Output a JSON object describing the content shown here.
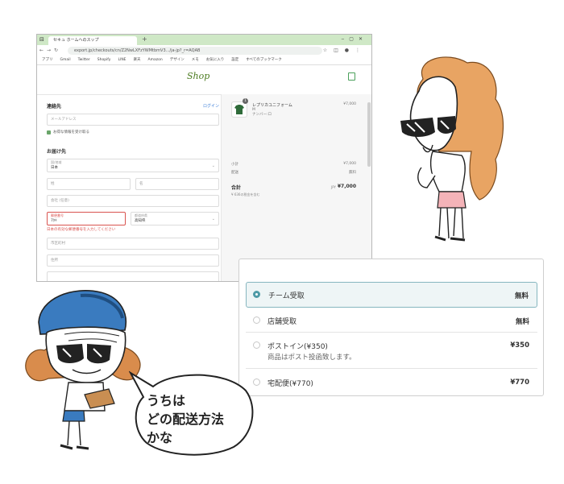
{
  "browser": {
    "tab_title": "セキュ ホームへのスップ",
    "url": "export.jp/checkouts/cn/Z2NwLXFzYWMtbmV3.../ja-jp?_r=AQAB",
    "bookmarks": [
      "アプリ",
      "Gmail",
      "Twitter",
      "Shopify",
      "LINE",
      "楽天",
      "Amazon",
      "デザイン",
      "メモ",
      "お気に入り",
      "設定",
      "すべてのブックマーク"
    ]
  },
  "shop": {
    "logo": "Shop"
  },
  "contact": {
    "heading": "連絡先",
    "login_link": "ログイン",
    "email_placeholder": "メールアドレス",
    "newsletter_label": "お得な情報を受け取る"
  },
  "delivery": {
    "heading": "お届け先",
    "country_label": "国/地域",
    "country_value": "日本",
    "last_name_placeholder": "姓",
    "first_name_placeholder": "名",
    "company_placeholder": "会社 (任意)",
    "postal_label": "郵便番号",
    "postal_value": "7ﾀｷ",
    "prefecture_label": "都道府県",
    "prefecture_value": "高知県",
    "postal_error": "日本の有効な郵便番号を入力してください",
    "city_placeholder": "市区町村",
    "address_placeholder": "住所"
  },
  "summary": {
    "item_name": "レプリカユニフォーム",
    "item_variant": "M",
    "item_variant2": "ナンバー:ロ",
    "item_qty": "1",
    "item_price": "¥7,000",
    "subtotal_label": "小計",
    "subtotal_value": "¥7,000",
    "shipping_label": "配送",
    "shipping_value": "無料",
    "total_label": "合計",
    "total_currency": "JPY",
    "total_value": "¥7,000",
    "tax_note": "¥ 636の税金を含む"
  },
  "shipping_options": [
    {
      "name": "チーム受取",
      "sub": "",
      "price": "無料",
      "selected": true
    },
    {
      "name": "店舗受取",
      "sub": "",
      "price": "無料",
      "selected": false
    },
    {
      "name": "ポストイン(¥350)",
      "sub": "商品はポスト投函致します。",
      "price": "¥350",
      "selected": false
    },
    {
      "name": "宅配便(¥770)",
      "sub": "",
      "price": "¥770",
      "selected": false
    }
  ],
  "bubble": {
    "text": "うちは\nどの配送方法\nかな"
  },
  "colors": {
    "hair_orange": "#e8a463",
    "cap_blue": "#3a7bbf",
    "selected_border": "#86b6bf",
    "error_red": "#d9534f",
    "tab_green": "#cfe8c6"
  }
}
